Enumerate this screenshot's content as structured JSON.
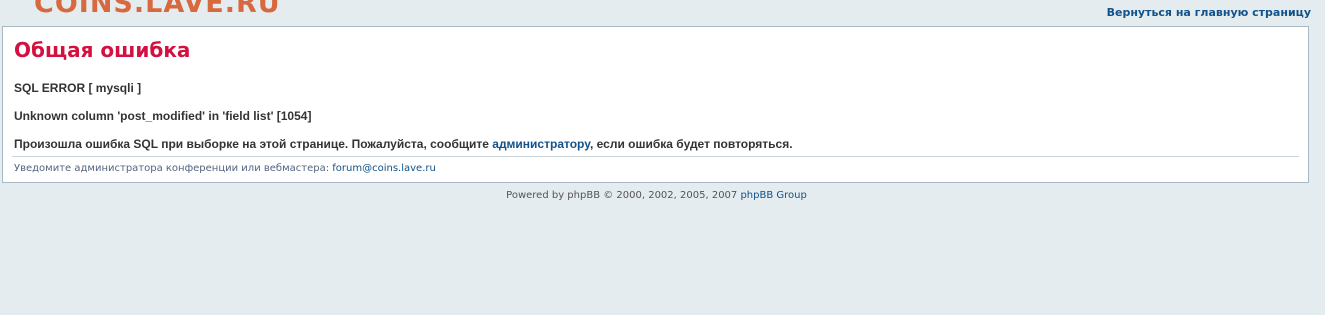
{
  "header": {
    "logo_text": "COINS.LAVE.RU",
    "home_link": "Вернуться на главную страницу"
  },
  "panel": {
    "title": "Общая ошибка",
    "sql_error": "SQL ERROR [ mysqli ]",
    "error_detail": "Unknown column 'post_modified' in 'field list' [1054]",
    "message_before": "Произошла ошибка SQL при выборке на этой странице. Пожалуйста, сообщите ",
    "message_link": "администратору",
    "message_after": ", если ошибка будет повторяться.",
    "notify_text": "Уведомите администратора конференции или вебмастера: ",
    "notify_email": "forum@coins.lave.ru"
  },
  "footer": {
    "powered_text": "Powered by phpBB © 2000, 2002, 2005, 2007 ",
    "powered_link": "phpBB Group"
  },
  "colors": {
    "background": "#e4ecef",
    "logo": "#d8693f",
    "title": "#d31141",
    "link": "#105289"
  }
}
